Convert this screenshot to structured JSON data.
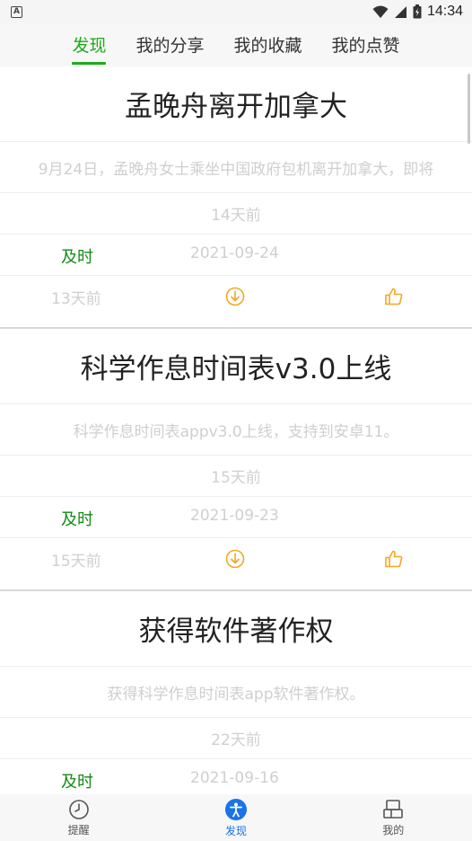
{
  "status_bar": {
    "time": "14:34",
    "left_icon": "A",
    "icons": [
      "wifi-icon",
      "signal-icon",
      "battery-icon"
    ]
  },
  "tabs": [
    {
      "label": "发现",
      "active": true
    },
    {
      "label": "我的分享",
      "active": false
    },
    {
      "label": "我的收藏",
      "active": false
    },
    {
      "label": "我的点赞",
      "active": false
    }
  ],
  "posts": [
    {
      "title": "孟晚舟离开加拿大",
      "summary": "9月24日，孟晚舟女士乘坐中国政府包机离开加拿大，即将",
      "ago": "14天前",
      "tag": "及时",
      "date": "2021-09-24",
      "ago2": "13天前"
    },
    {
      "title": "科学作息时间表v3.0上线",
      "summary": "科学作息时间表appv3.0上线，支持到安卓11。",
      "ago": "15天前",
      "tag": "及时",
      "date": "2021-09-23",
      "ago2": "15天前"
    },
    {
      "title": "获得软件著作权",
      "summary": "获得科学作息时间表app软件著作权。",
      "ago": "22天前",
      "tag": "及时",
      "date": "2021-09-16",
      "ago2": ""
    }
  ],
  "bottom_nav": [
    {
      "label": "提醒",
      "icon": "clock-icon",
      "active": false
    },
    {
      "label": "发现",
      "icon": "person-icon",
      "active": true
    },
    {
      "label": "我的",
      "icon": "profile-icon",
      "active": false
    }
  ],
  "colors": {
    "accent": "#1aad19",
    "tag": "#138a13",
    "icon_orange": "#f5a623",
    "nav_active": "#1a73e8"
  }
}
